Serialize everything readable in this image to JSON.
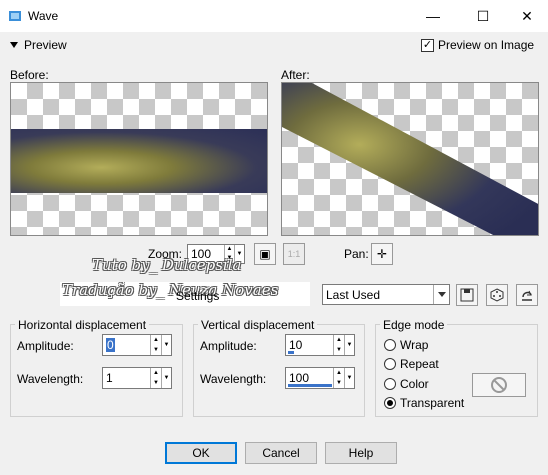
{
  "window": {
    "title": "Wave",
    "icon": "app-icon"
  },
  "preview": {
    "toggle_label": "Preview",
    "preview_on_image_label": "Preview on Image",
    "preview_on_image_checked": true,
    "before_label": "Before:",
    "after_label": "After:"
  },
  "zoom": {
    "label": "Zoom:",
    "value": "100"
  },
  "pan": {
    "label": "Pan:"
  },
  "settings": {
    "label": "Settings",
    "preset": "Last Used"
  },
  "watermark": {
    "line1": "Tuto by_ Dulcepsila",
    "line2": "Tradução by_ Neuza Novaes"
  },
  "horizontal": {
    "title": "Horizontal displacement",
    "amplitude_label": "Amplitude:",
    "amplitude": "0",
    "wavelength_label": "Wavelength:",
    "wavelength": "1"
  },
  "vertical": {
    "title": "Vertical displacement",
    "amplitude_label": "Amplitude:",
    "amplitude": "10",
    "wavelength_label": "Wavelength:",
    "wavelength": "100"
  },
  "edge_mode": {
    "title": "Edge mode",
    "options": [
      "Wrap",
      "Repeat",
      "Color",
      "Transparent"
    ],
    "selected": "Transparent"
  },
  "buttons": {
    "ok": "OK",
    "cancel": "Cancel",
    "help": "Help"
  },
  "icons": {
    "minimize": "minimize-icon",
    "maximize": "maximize-icon",
    "close": "close-icon",
    "pan": "move-icon",
    "save_preset": "save-icon",
    "randomize": "dice-icon",
    "reset": "reset-icon",
    "color": "no-color-icon"
  }
}
